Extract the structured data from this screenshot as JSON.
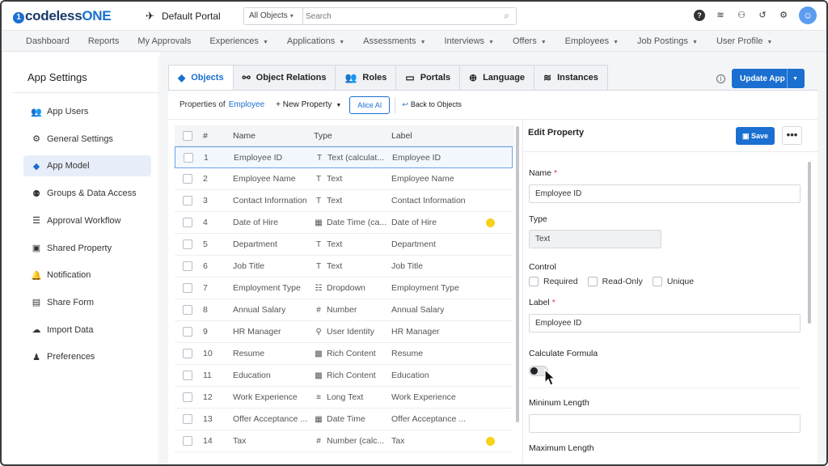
{
  "topbar": {
    "logo_text": "codelessONE",
    "logo_brand": "codeless",
    "logo_accent": "ONE",
    "portal": "Default Portal",
    "search_scope": "All Objects",
    "search_placeholder": "Search",
    "icons": [
      "help-icon",
      "database-icon",
      "add-user-icon",
      "history-icon",
      "gear-icon",
      "user-avatar-icon"
    ]
  },
  "nav": {
    "items": [
      {
        "label": "Dashboard",
        "dropdown": false
      },
      {
        "label": "Reports",
        "dropdown": false
      },
      {
        "label": "My Approvals",
        "dropdown": false
      },
      {
        "label": "Experiences",
        "dropdown": true
      },
      {
        "label": "Applications",
        "dropdown": true
      },
      {
        "label": "Assessments",
        "dropdown": true
      },
      {
        "label": "Interviews",
        "dropdown": true
      },
      {
        "label": "Offers",
        "dropdown": true
      },
      {
        "label": "Employees",
        "dropdown": true
      },
      {
        "label": "Job Postings",
        "dropdown": true
      },
      {
        "label": "User Profile",
        "dropdown": true
      }
    ]
  },
  "sidebar": {
    "title": "App Settings",
    "items": [
      {
        "label": "App Users",
        "icon": "users-icon"
      },
      {
        "label": "General Settings",
        "icon": "gear-icon"
      },
      {
        "label": "App Model",
        "icon": "cube-icon",
        "active": true
      },
      {
        "label": "Groups & Data Access",
        "icon": "group-icon"
      },
      {
        "label": "Approval Workflow",
        "icon": "checklist-icon"
      },
      {
        "label": "Shared Property",
        "icon": "shared-icon"
      },
      {
        "label": "Notification",
        "icon": "bell-icon"
      },
      {
        "label": "Share Form",
        "icon": "form-icon"
      },
      {
        "label": "Import Data",
        "icon": "cloud-upload-icon"
      },
      {
        "label": "Preferences",
        "icon": "preferences-icon"
      }
    ]
  },
  "tabs": [
    {
      "label": "Objects",
      "icon": "cube-icon",
      "active": true
    },
    {
      "label": "Object Relations",
      "icon": "relations-icon"
    },
    {
      "label": "Roles",
      "icon": "roles-icon"
    },
    {
      "label": "Portals",
      "icon": "monitor-icon"
    },
    {
      "label": "Language",
      "icon": "globe-icon"
    },
    {
      "label": "Instances",
      "icon": "database-icon"
    }
  ],
  "update_app_label": "Update App",
  "toolbar": {
    "properties_of": "Properties of",
    "object_name": "Employee",
    "new_property": "New Property",
    "alice_ai": "Alice AI",
    "back_to_objects": "Back to Objects"
  },
  "table": {
    "headers": {
      "num": "#",
      "name": "Name",
      "type": "Type",
      "label": "Label"
    },
    "rows": [
      {
        "num": "1",
        "name": "Employee ID",
        "type": "Text (calculat...",
        "type_icon": "T",
        "label": "Employee ID",
        "selected": true,
        "flag": false
      },
      {
        "num": "2",
        "name": "Employee Name",
        "type": "Text",
        "type_icon": "T",
        "label": "Employee Name",
        "flag": false
      },
      {
        "num": "3",
        "name": "Contact Information",
        "type": "Text",
        "type_icon": "T",
        "label": "Contact Information",
        "flag": false
      },
      {
        "num": "4",
        "name": "Date of Hire",
        "type": "Date Time (ca...",
        "type_icon": "cal",
        "label": "Date of Hire",
        "flag": true
      },
      {
        "num": "5",
        "name": "Department",
        "type": "Text",
        "type_icon": "T",
        "label": "Department",
        "flag": false
      },
      {
        "num": "6",
        "name": "Job Title",
        "type": "Text",
        "type_icon": "T",
        "label": "Job Title",
        "flag": false
      },
      {
        "num": "7",
        "name": "Employment Type",
        "type": "Dropdown",
        "type_icon": "list",
        "label": "Employment Type",
        "flag": false
      },
      {
        "num": "8",
        "name": "Annual Salary",
        "type": "Number",
        "type_icon": "#",
        "label": "Annual Salary",
        "flag": false
      },
      {
        "num": "9",
        "name": "HR Manager",
        "type": "User Identity",
        "type_icon": "user",
        "label": "HR Manager",
        "flag": false
      },
      {
        "num": "10",
        "name": "Resume",
        "type": "Rich Content",
        "type_icon": "rich",
        "label": "Resume",
        "flag": false
      },
      {
        "num": "11",
        "name": "Education",
        "type": "Rich Content",
        "type_icon": "rich",
        "label": "Education",
        "flag": false
      },
      {
        "num": "12",
        "name": "Work Experience",
        "type": "Long Text",
        "type_icon": "lines",
        "label": "Work Experience",
        "flag": false
      },
      {
        "num": "13",
        "name": "Offer Acceptance ...",
        "type": "Date Time",
        "type_icon": "cal",
        "label": "Offer Acceptance ...",
        "flag": false
      },
      {
        "num": "14",
        "name": "Tax",
        "type": "Number (calc...",
        "type_icon": "#",
        "label": "Tax",
        "flag": true
      }
    ]
  },
  "edit": {
    "title": "Edit Property",
    "save_label": "Save",
    "more_label": "•••",
    "name_label": "Name",
    "name_value": "Employee ID",
    "type_label": "Type",
    "type_value": "Text",
    "control_label": "Control",
    "control_options": [
      "Required",
      "Read-Only",
      "Unique"
    ],
    "label_label": "Label",
    "label_value": "Employee ID",
    "calc_label": "Calculate Formula",
    "min_length_label": "Mininum Length",
    "max_length_label": "Maximum Length"
  },
  "colors": {
    "accent": "#1a6fd0",
    "flag": "#f5d31c"
  }
}
